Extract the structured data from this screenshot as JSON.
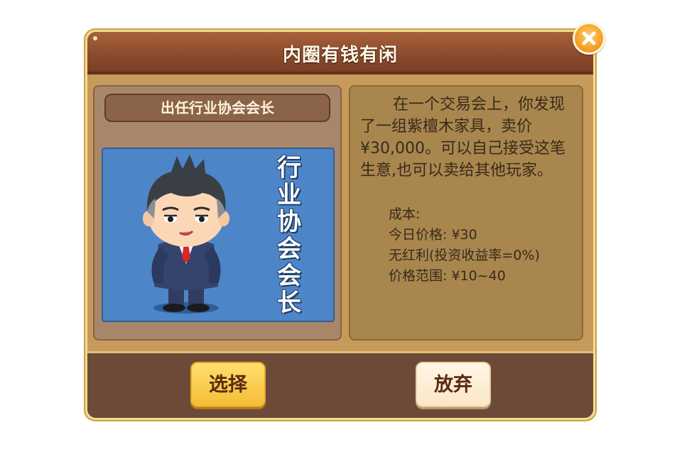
{
  "dialog": {
    "title": "内圈有钱有闲"
  },
  "card": {
    "title": "出任行业协会会长",
    "image_vertical_text": "行业协会会长"
  },
  "description": {
    "text": "在一个交易会上，你发现了一组紫檀木家具，卖价¥30,000。可以自己接受这笔生意,也可以卖给其他玩家。"
  },
  "stats": {
    "cost_label": "成本:",
    "today_price": "今日价格: ¥30",
    "dividend": "无红利(投资收益率=0%)",
    "price_range": "价格范围: ¥10~40"
  },
  "buttons": {
    "select_label": "选择",
    "abandon_label": "放弃"
  },
  "icons": {
    "close": "close-icon",
    "character": "businessman-character-icon"
  },
  "colors": {
    "title_bar": "#8a4a2c",
    "select_button": "#f6bd36",
    "abandon_button": "#fbe6c8",
    "card_image_bg": "#4d86c8",
    "close_button": "#f39a1e"
  }
}
